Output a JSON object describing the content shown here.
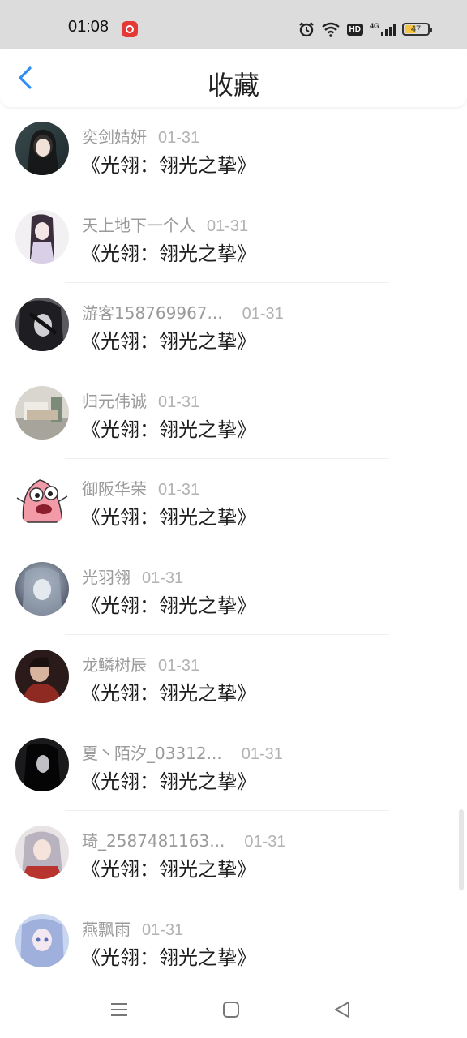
{
  "status_bar": {
    "time": "01:08",
    "icons": [
      "app-notification-icon",
      "alarm-icon",
      "wifi-icon",
      "hd-icon",
      "4g-signal-icon"
    ],
    "network": "4G",
    "hd": "HD",
    "battery": "47",
    "battery_level": 0.47
  },
  "header": {
    "title": "收藏",
    "back_icon": "chevron-left-icon",
    "accent": "#2e8ef5"
  },
  "items": [
    {
      "name": "奕剑婧妍",
      "date": "01-31",
      "title": "《光翎：翎光之挚》"
    },
    {
      "name": "天上地下一个人",
      "date": "01-31",
      "title": "《光翎：翎光之挚》"
    },
    {
      "name": "游客158769967...",
      "date": "01-31",
      "title": "《光翎：翎光之挚》"
    },
    {
      "name": "归元伟诚",
      "date": "01-31",
      "title": "《光翎：翎光之挚》"
    },
    {
      "name": "御阪华荣",
      "date": "01-31",
      "title": "《光翎：翎光之挚》"
    },
    {
      "name": "光羽翎",
      "date": "01-31",
      "title": "《光翎：翎光之挚》"
    },
    {
      "name": "龙鳞树辰",
      "date": "01-31",
      "title": "《光翎：翎光之挚》"
    },
    {
      "name": "夏丶陌汐_03312...",
      "date": "01-31",
      "title": "《光翎：翎光之挚》"
    },
    {
      "name": "琦_2587481163...",
      "date": "01-31",
      "title": "《光翎：翎光之挚》"
    },
    {
      "name": "燕飘雨",
      "date": "01-31",
      "title": "《光翎：翎光之挚》"
    }
  ],
  "system_nav": {
    "icons": [
      "menu-icon",
      "home-icon",
      "back-triangle-icon"
    ]
  }
}
